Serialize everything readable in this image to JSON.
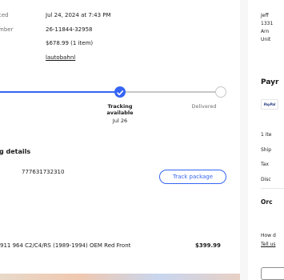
{
  "order_info": {
    "placed_label": "ced",
    "placed_value": "Jul 24, 2024 at 7:43 PM",
    "number_label": "mber",
    "number_value": "26-11844-32958",
    "total_value": "$678.99 (1 item)",
    "seller_link": "lautobahnl"
  },
  "tracking_progress": {
    "steps": [
      {
        "label": "",
        "state": "done"
      },
      {
        "label": "Tracking available",
        "date": "Jul 26",
        "state": "current"
      },
      {
        "label": "Delivered",
        "state": "pending"
      }
    ],
    "colors": {
      "done": "#3665f3",
      "pending": "#c7c7c7"
    }
  },
  "shipping": {
    "section_title": "g details",
    "tracking_number": "777631732310",
    "track_button": "Track package"
  },
  "item": {
    "title": "911 964 C2/C4/RS (1989-1994) OEM Red Front",
    "price": "$399.99"
  },
  "right_panel": {
    "address_lines": [
      "Jeff",
      "1331",
      "Arn",
      "Unit"
    ],
    "payment_title": "Payr",
    "payment_icon": "paypal-icon",
    "summary_lines": [
      "1 ite",
      "Ship",
      "Tax",
      "Disc"
    ],
    "order_total_label": "Orc",
    "help_text": "How d",
    "help_link": "Tell us"
  }
}
